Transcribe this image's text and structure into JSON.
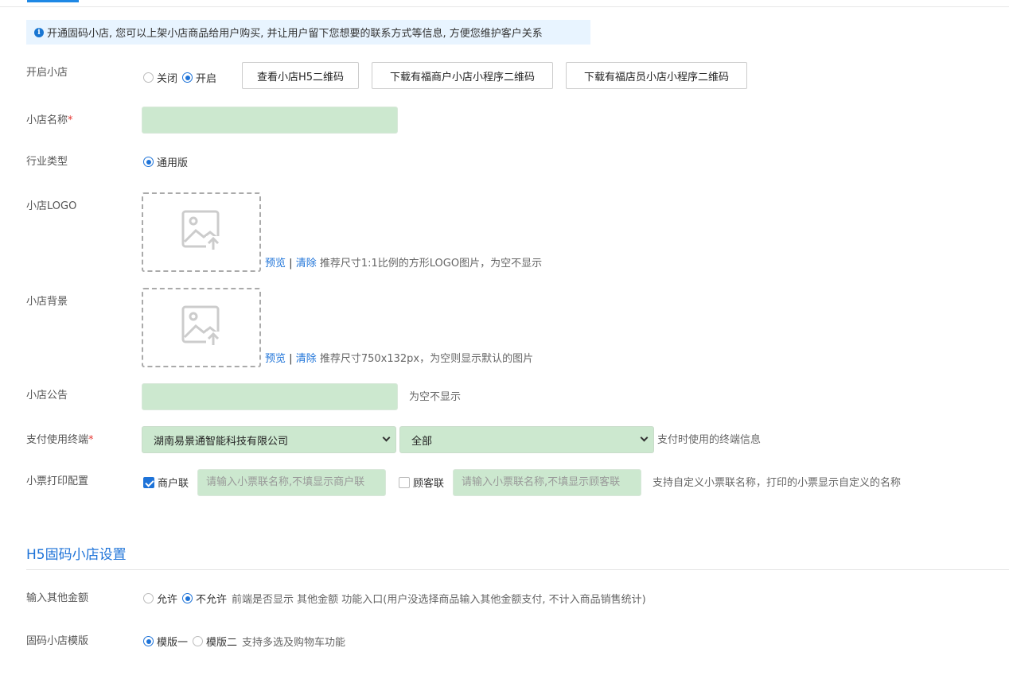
{
  "notice": {
    "text": "开通固码小店, 您可以上架小店商品给用户购买, 并让用户留下您想要的联系方式等信息, 方便您维护客户关系"
  },
  "shop_enable": {
    "label": "开启小店",
    "options": [
      "关闭",
      "开启"
    ],
    "selected": "开启",
    "buttons": [
      "查看小店H5二维码",
      "下载有福商户小店小程序二维码",
      "下载有福店员小店小程序二维码"
    ]
  },
  "shop_name": {
    "label": "小店名称",
    "required_mark": "*",
    "value": ""
  },
  "industry": {
    "label": "行业类型",
    "option": "通用版",
    "selected": true
  },
  "logo": {
    "label": "小店LOGO",
    "preview_link": "预览",
    "separator": "|",
    "clear_link": "清除",
    "hint": "推荐尺寸1:1比例的方形LOGO图片，为空不显示"
  },
  "background": {
    "label": "小店背景",
    "preview_link": "预览",
    "separator": "|",
    "clear_link": "清除",
    "hint": "推荐尺寸750x132px，为空则显示默认的图片"
  },
  "announcement": {
    "label": "小店公告",
    "value": "",
    "hint": "为空不显示"
  },
  "payment_terminal": {
    "label": "支付使用终端",
    "required_mark": "*",
    "company_select": "湖南易景通智能科技有限公司",
    "terminal_select": "全部",
    "hint": "支付时使用的终端信息"
  },
  "receipt": {
    "label": "小票打印配置",
    "merchant_copy": {
      "label": "商户联",
      "checked": true,
      "placeholder": "请输入小票联名称,不填显示商户联"
    },
    "customer_copy": {
      "label": "顾客联",
      "checked": false,
      "placeholder": "请输入小票联名称,不填显示顾客联"
    },
    "hint": "支持自定义小票联名称，打印的小票显示自定义的名称"
  },
  "h5_section": {
    "title": "H5固码小店设置"
  },
  "other_amount": {
    "label": "输入其他金额",
    "options": [
      "允许",
      "不允许"
    ],
    "selected": "不允许",
    "hint": "前端是否显示 其他金额 功能入口(用户没选择商品输入其他金额支付, 不计入商品销售统计)"
  },
  "template": {
    "label": "固码小店模版",
    "options": [
      "模版一",
      "模版二"
    ],
    "selected": "模版一",
    "hint": "支持多选及购物车功能"
  },
  "colors": {
    "accent": "#1e73d8",
    "input_bg": "#cce8cf",
    "notice_bg": "#e8f4ff",
    "required": "#e53935"
  },
  "icons": {
    "notice": "info-icon",
    "upload": "image-upload-icon"
  }
}
